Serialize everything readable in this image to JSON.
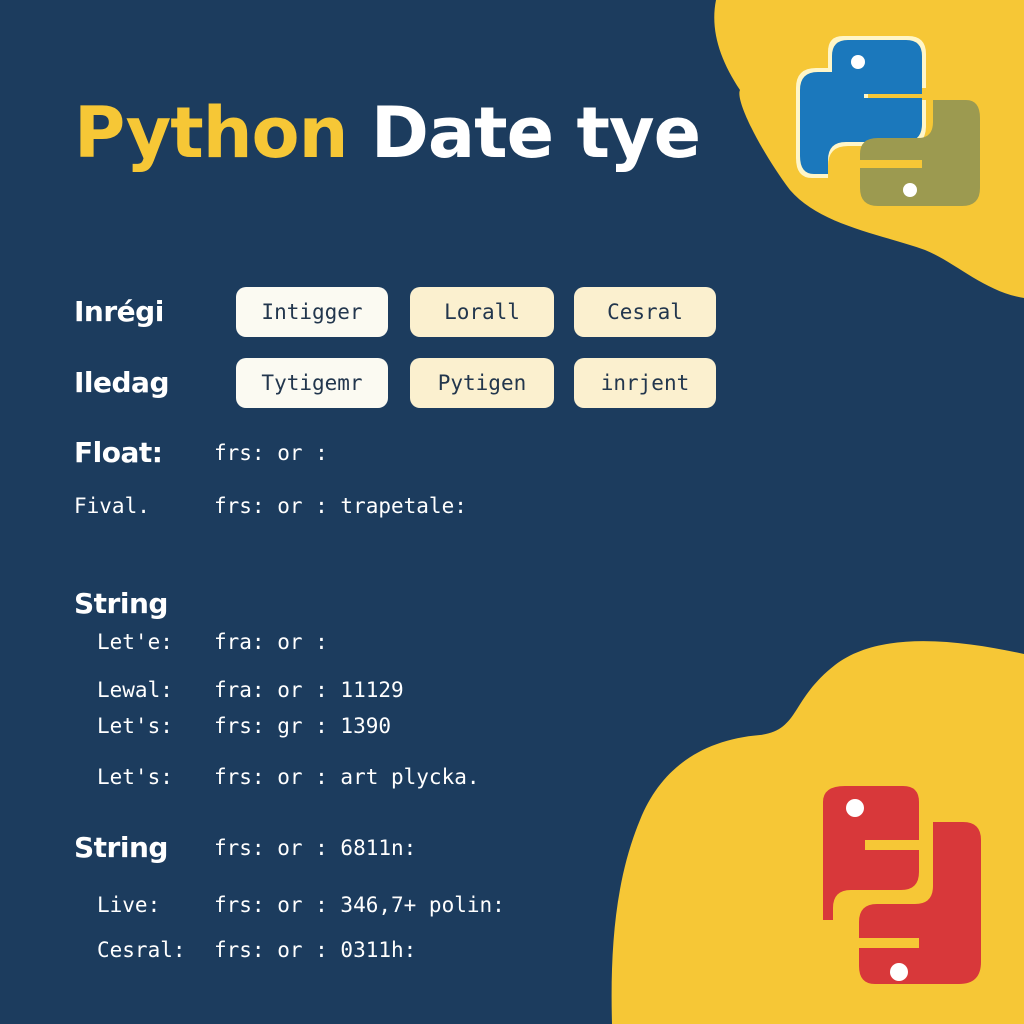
{
  "title": {
    "word1": "Python",
    "word2": "Date tye"
  },
  "rows": {
    "r1": {
      "label": "Inrégi",
      "chips": [
        "Intigger",
        "Lorall",
        "Cesral"
      ]
    },
    "r2": {
      "label": "Iledag",
      "chips": [
        "Tytigemr",
        "Pytigen",
        "inrjent"
      ]
    }
  },
  "float": {
    "heading": "Float:",
    "heading_value": "frs: or :",
    "sub_label": "Fival.",
    "sub_value": "frs: or :  trapetale:"
  },
  "string1": {
    "heading": "String",
    "items": [
      {
        "label": "Let'e:",
        "value": "fra: or :"
      },
      {
        "label": "Lewal:",
        "value": "fra: or : 11129"
      },
      {
        "label": "Let's:",
        "value": "frs: gr : 1390"
      },
      {
        "label": "Let's:",
        "value": "frs: or : art plycka."
      }
    ]
  },
  "string2": {
    "heading": "String",
    "heading_value": "frs: or : 6811n:",
    "items": [
      {
        "label": "Live:",
        "value": "frs: or : 346,7+ polin:"
      },
      {
        "label": "Cesral:",
        "value": "frs: or : 0311h:"
      }
    ]
  },
  "icons": {
    "top_logo": "python-logo-icon",
    "bottom_logo": "python-logo-icon"
  },
  "colors": {
    "background": "#1c3c5e",
    "yellow": "#f6c736",
    "blue": "#1b78bc",
    "olive": "#9c9a50",
    "red": "#d8383a"
  }
}
